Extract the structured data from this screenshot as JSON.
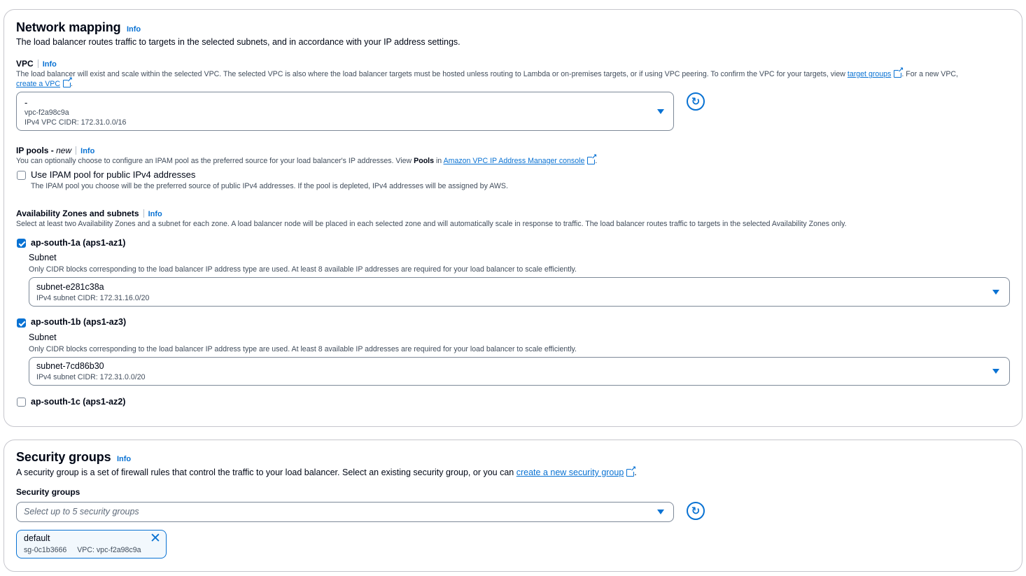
{
  "network_mapping": {
    "title": "Network mapping",
    "info": "Info",
    "description": "The load balancer routes traffic to targets in the selected subnets, and in accordance with your IP address settings.",
    "vpc": {
      "label": "VPC",
      "info": "Info",
      "description_part1": "The load balancer will exist and scale within the selected VPC. The selected VPC is also where the load balancer targets must be hosted unless routing to Lambda or on-premises targets, or if using VPC peering. To confirm the VPC for your targets, view",
      "target_groups_link": "target groups",
      "description_part2": ". For a new VPC,",
      "create_vpc_link": "create a VPC",
      "description_part3": ".",
      "selected_name": "-",
      "selected_id": "vpc-f2a98c9a",
      "selected_cidr": "IPv4 VPC CIDR: 172.31.0.0/16"
    },
    "ip_pools": {
      "label": "IP pools - ",
      "label_new": "new",
      "info": "Info",
      "description_part1": "You can optionally choose to configure an IPAM pool as the preferred source for your load balancer's IP addresses. View",
      "pools_bold": "Pools",
      "description_in": "in",
      "ipam_link": "Amazon VPC IP Address Manager console",
      "description_end": ".",
      "checkbox_label": "Use IPAM pool for public IPv4 addresses",
      "checkbox_description": "The IPAM pool you choose will be the preferred source of public IPv4 addresses. If the pool is depleted, IPv4 addresses will be assigned by AWS.",
      "checked": false
    },
    "az": {
      "label": "Availability Zones and subnets",
      "info": "Info",
      "description": "Select at least two Availability Zones and a subnet for each zone. A load balancer node will be placed in each selected zone and will automatically scale in response to traffic. The load balancer routes traffic to targets in the selected Availability Zones only.",
      "zones": [
        {
          "name": "ap-south-1a (aps1-az1)",
          "checked": true,
          "subnet_label": "Subnet",
          "subnet_description": "Only CIDR blocks corresponding to the load balancer IP address type are used. At least 8 available IP addresses are required for your load balancer to scale efficiently.",
          "subnet_id": "subnet-e281c38a",
          "subnet_cidr": "IPv4 subnet CIDR: 172.31.16.0/20"
        },
        {
          "name": "ap-south-1b (aps1-az3)",
          "checked": true,
          "subnet_label": "Subnet",
          "subnet_description": "Only CIDR blocks corresponding to the load balancer IP address type are used. At least 8 available IP addresses are required for your load balancer to scale efficiently.",
          "subnet_id": "subnet-7cd86b30",
          "subnet_cidr": "IPv4 subnet CIDR: 172.31.0.0/20"
        },
        {
          "name": "ap-south-1c (aps1-az2)",
          "checked": false
        }
      ]
    }
  },
  "security_groups": {
    "title": "Security groups",
    "info": "Info",
    "description_part1": "A security group is a set of firewall rules that control the traffic to your load balancer. Select an existing security group, or you can",
    "create_link": "create a new security group",
    "description_end": ".",
    "field_label": "Security groups",
    "placeholder": "Select up to 5 security groups",
    "selected": [
      {
        "name": "default",
        "id": "sg-0c1b3666",
        "vpc": "VPC: vpc-f2a98c9a"
      }
    ]
  },
  "colors": {
    "accent": "#0972d3",
    "border": "#c6c6cd",
    "input_border": "#7d8998",
    "text": "#000716",
    "muted": "#414d5c"
  },
  "icons": [
    "caret-down-icon",
    "refresh-icon",
    "external-link-icon",
    "checkbox-icon",
    "close-icon"
  ]
}
